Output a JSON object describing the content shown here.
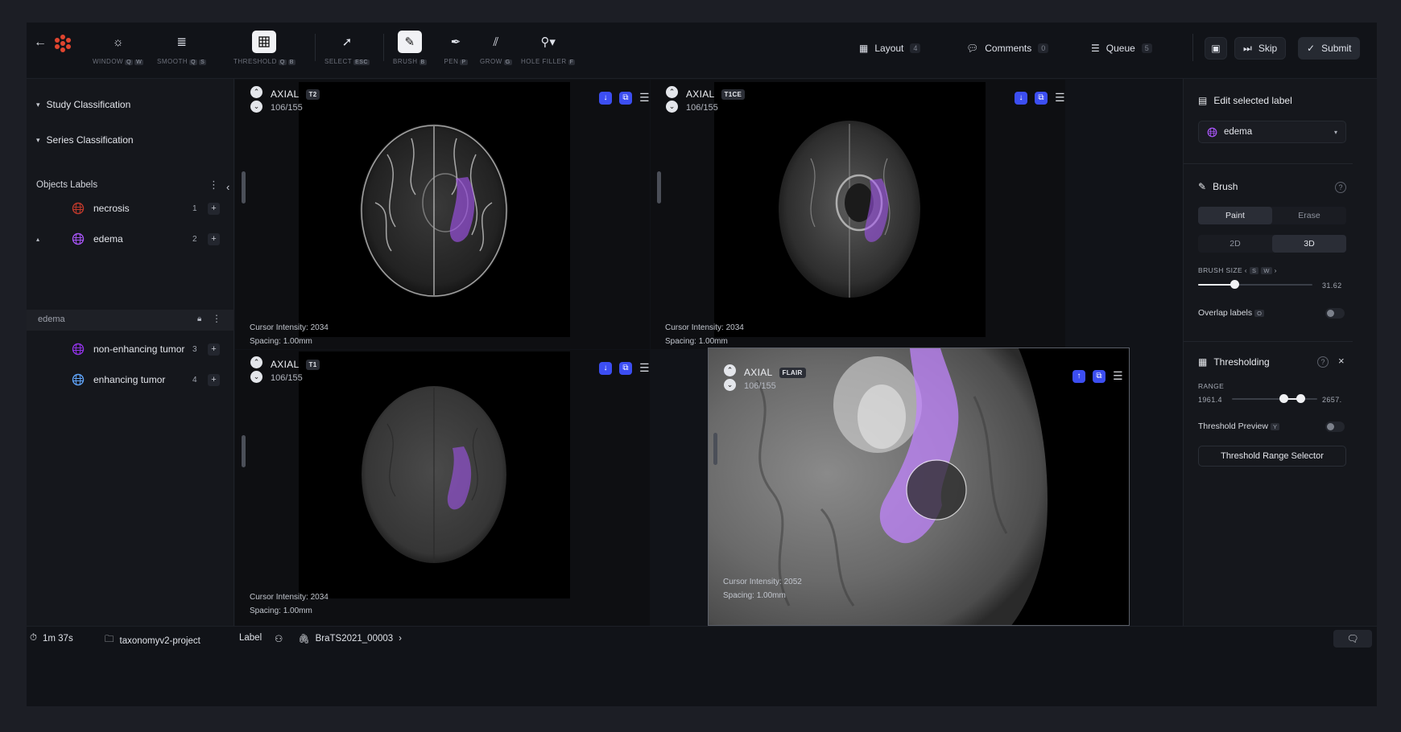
{
  "toolbar": {
    "tools": [
      {
        "label": "WINDOW",
        "keys": [
          "Q",
          "W"
        ],
        "icon": "sun-icon",
        "active": false
      },
      {
        "label": "SMOOTH",
        "keys": [
          "Q",
          "S"
        ],
        "icon": "layers-icon",
        "active": false
      },
      {
        "label": "THRESHOLD",
        "keys": [
          "Q",
          "B"
        ],
        "icon": "grid-icon",
        "active": true
      },
      {
        "label": "SELECT",
        "keys": [
          "ESC"
        ],
        "icon": "cursor-icon",
        "active": false
      },
      {
        "label": "BRUSH",
        "keys": [
          "B"
        ],
        "icon": "brush-icon",
        "active": true
      },
      {
        "label": "PEN",
        "keys": [
          "P"
        ],
        "icon": "pen-icon",
        "active": false
      },
      {
        "label": "GROW",
        "keys": [
          "G"
        ],
        "icon": "grow-icon",
        "active": false
      },
      {
        "label": "HOLE FILLER",
        "keys": [
          "F"
        ],
        "icon": "hole-filler-icon",
        "active": false
      }
    ],
    "layout": {
      "label": "Layout",
      "count": "4"
    },
    "comments": {
      "label": "Comments",
      "count": "0"
    },
    "queue": {
      "label": "Queue",
      "count": "5"
    },
    "skip_label": "Skip",
    "submit_label": "Submit"
  },
  "sidebar": {
    "study_classification": "Study Classification",
    "series_classification": "Series Classification",
    "objects_labels": "Objects Labels",
    "labels": [
      {
        "name": "necrosis",
        "count": "1",
        "color": "#c0392b",
        "expanded": false
      },
      {
        "name": "edema",
        "count": "2",
        "color": "#a855f7",
        "expanded": true
      },
      {
        "name": "non-enhancing tumor",
        "count": "3",
        "color": "#9333ea",
        "expanded": false
      },
      {
        "name": "enhancing tumor",
        "count": "4",
        "color": "#60a5fa",
        "expanded": false
      }
    ],
    "selected_instance": "edema"
  },
  "viewports": [
    {
      "view": "AXIAL",
      "sequence": "T2",
      "slice": "106/155",
      "cursor": "Cursor Intensity: 2034",
      "spacing": "Spacing: 1.00mm"
    },
    {
      "view": "AXIAL",
      "sequence": "T1CE",
      "slice": "106/155",
      "cursor": "Cursor Intensity: 2034",
      "spacing": "Spacing: 1.00mm"
    },
    {
      "view": "AXIAL",
      "sequence": "T1",
      "slice": "106/155",
      "cursor": "Cursor Intensity: 2034",
      "spacing": "Spacing: 1.00mm"
    },
    {
      "view": "AXIAL",
      "sequence": "FLAIR",
      "slice": "106/155",
      "cursor": "Cursor Intensity: 2052",
      "spacing": "Spacing: 1.00mm"
    }
  ],
  "right_panel": {
    "edit_title": "Edit selected label",
    "selected_label": "edema",
    "brush_title": "Brush",
    "paint": "Paint",
    "erase": "Erase",
    "mode_2d": "2D",
    "mode_3d": "3D",
    "brush_size_label": "BRUSH SIZE",
    "brush_size_keys": [
      "S",
      "W"
    ],
    "brush_size_value": "31.62",
    "brush_size_fraction": 0.32,
    "overlap_labels": "Overlap labels",
    "overlap_key": "O",
    "thresholding_title": "Thresholding",
    "range_label": "RANGE",
    "range_min": "1961.4",
    "range_max": "2657.",
    "range_low_fraction": 0.6,
    "range_high_fraction": 0.8,
    "threshold_preview": "Threshold Preview",
    "threshold_preview_key": "Y",
    "threshold_range_selector": "Threshold Range Selector"
  },
  "status": {
    "timer": "1m 37s",
    "project": "taxonomyv2-project",
    "mode": "Label",
    "case": "BraTS2021_00003"
  },
  "colors": {
    "accent": "#3c4ef2",
    "label_overlay": "#a855f7"
  }
}
